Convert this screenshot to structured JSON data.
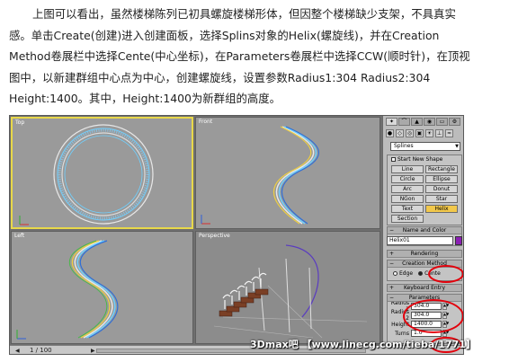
{
  "article": {
    "lines": [
      "上图可以看出，虽然楼梯陈列已初具螺旋楼梯形体，但因整个楼梯缺少支架，不具真实",
      "感。单击Create(创建)进入创建面板，选择Splins对象的Helix(螺旋线)，并在Creation",
      "Method卷展栏中选择Cente(中心坐标)，在Parameters卷展栏中选择CCW(顺时针)，在顶视",
      "图中，以新建群组中心点为中心，创建螺旋线，设置参数Radius1:304 Radius2:304",
      "Height:1400。其中，Height:1400为新群组的高度。"
    ]
  },
  "viewports": {
    "top_label": "Top",
    "front_label": "Front",
    "left_label": "Left",
    "perspective_label": "Perspective"
  },
  "statusbar": {
    "page_counter": "1 / 100"
  },
  "panel": {
    "tabs": [
      "✦",
      "⌒",
      "▲",
      "◉",
      "▭",
      "⚙"
    ],
    "icon_row": [
      "●",
      "◇",
      "◎",
      "▣",
      "☀",
      "⊥",
      "≈"
    ],
    "category_dropdown": "Splines",
    "object_type": {
      "autogrid_label": "Start New Shape",
      "buttons": [
        "Line",
        "Rectangle",
        "Circle",
        "Ellipse",
        "Arc",
        "Donut",
        "NGon",
        "Star",
        "Text",
        "Helix",
        "Section"
      ],
      "selected": "Helix"
    },
    "name_and_color": {
      "title": "Name and Color",
      "name_value": "Helix01",
      "color": "#8a1fb3"
    },
    "rendering_title": "Rendering",
    "creation_method": {
      "title": "Creation Method",
      "options": [
        "Edge",
        "Cente"
      ],
      "selected": "Cente"
    },
    "keyboard_entry_title": "Keyboard Entry",
    "parameters": {
      "title": "Parameters",
      "rows": [
        {
          "label": "Radius 1",
          "value": "304.0"
        },
        {
          "label": "Radius 2",
          "value": "304.0"
        },
        {
          "label": "Height",
          "value": "1400.0"
        },
        {
          "label": "Turns",
          "value": "1.0"
        }
      ]
    }
  },
  "annotation_color": "#e2000b",
  "watermark": "3Dmax吧 【www.linecg.com/tieba/1771】"
}
